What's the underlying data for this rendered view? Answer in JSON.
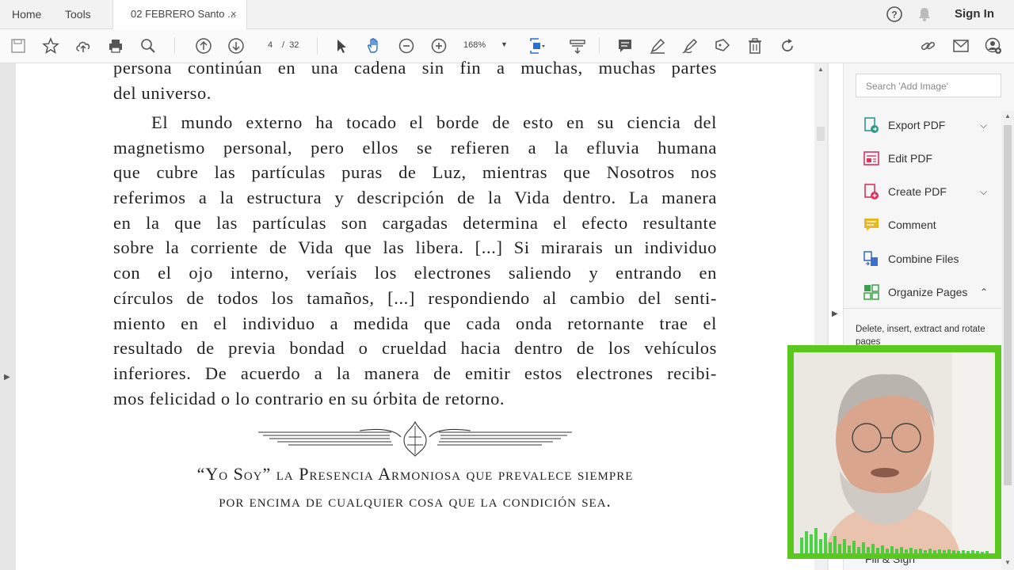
{
  "tabs": {
    "home": "Home",
    "tools": "Tools",
    "document": "02 FEBRERO Santo ...",
    "close": "×"
  },
  "header": {
    "sign_in": "Sign In"
  },
  "toolbar": {
    "page_current": "4",
    "page_separator": "/",
    "page_total": "32",
    "zoom": "168%"
  },
  "document": {
    "lines_top": [
      "persona continúan en una cadena sin fin a muchas, muchas partes",
      "del universo."
    ],
    "paragraph": [
      "El mundo externo ha tocado el borde de esto en su ciencia del",
      "magnetismo personal, pero ellos se refieren a la efluvia humana",
      "que cubre las partículas puras de Luz, mientras que Nosotros nos",
      "referimos a la estructura y descripción de la Vida dentro. La manera",
      "en la que las partículas son cargadas determina el efecto resultante",
      "sobre la corriente de Vida que las libera. [...] Si mirarais un individuo",
      "con el ojo interno, veríais los electrones saliendo y entrando en",
      "círculos de todos los tamaños, [...] respondiendo al cambio del senti-",
      "miento en el individuo a medida que cada onda retornante trae el",
      "resultado de previa bondad o crueldad hacia dentro de los vehículos",
      "inferiores. De acuerdo a la manera de emitir estos electrones recibi-",
      "mos felicidad o lo contrario en su órbita de retorno."
    ],
    "motto_line1": "“Yo Soy” la Presencia Armoniosa que prevalece siempre",
    "motto_line2": "por encima de cualquier cosa que la condición sea."
  },
  "rightpanel": {
    "search_placeholder": "Search 'Add Image'",
    "tools": [
      {
        "label": "Export PDF",
        "chevron": "⌄",
        "color": "#2e9a8a"
      },
      {
        "label": "Edit PDF",
        "chevron": "",
        "color": "#d9345d"
      },
      {
        "label": "Create PDF",
        "chevron": "⌄",
        "color": "#d9345d"
      },
      {
        "label": "Comment",
        "chevron": "",
        "color": "#e8b820"
      },
      {
        "label": "Combine Files",
        "chevron": "",
        "color": "#3d6fcf"
      },
      {
        "label": "Organize Pages",
        "chevron": "⌃",
        "color": "#3aa04a"
      }
    ],
    "description": "Delete, insert, extract and rotate pages",
    "fill_sign": "Fill & Sign"
  }
}
